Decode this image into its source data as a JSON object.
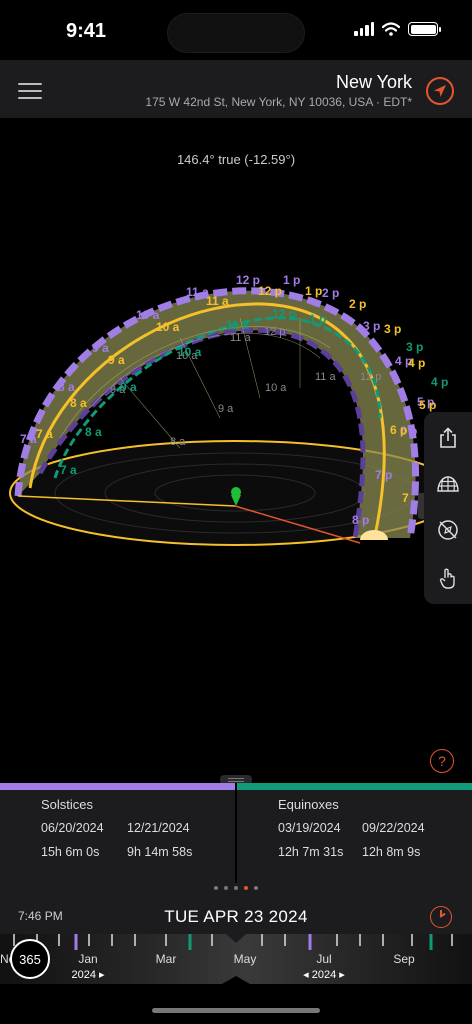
{
  "status_bar": {
    "time": "9:41"
  },
  "header": {
    "title": "New York",
    "address": "175 W 42nd St, New York, NY 10036, USA · EDT*"
  },
  "viewer": {
    "bearing": "146.4° true (-12.59°)",
    "help_label": "?",
    "winter_path_labels": [
      "7 a",
      "8 a",
      "9 a",
      "10 a",
      "11 a",
      "12 p",
      "1 p",
      "2 p",
      "3 p",
      "4 p"
    ],
    "equinox_path_labels": [
      "7 a",
      "8 a",
      "9 a",
      "10 a",
      "11 a",
      "12 p",
      "1 p",
      "2 p",
      "3 p",
      "4 p",
      "5 p",
      "6 p",
      "7 p"
    ],
    "summer_path_labels": [
      "7 a",
      "8 a",
      "9 a",
      "10 a",
      "11 a",
      "12 p",
      "1 p",
      "2 p",
      "3 p",
      "4 p",
      "5 p",
      "6 p",
      "7 p",
      "8 p"
    ],
    "today_path_labels": [
      "7 a",
      "8 a",
      "9 a",
      "10 a",
      "11 a",
      "12 p",
      "1 p",
      "2 p",
      "3 p",
      "4 p",
      "5 p",
      "6 p",
      "7"
    ],
    "colors": {
      "summer": "#a17de6",
      "winter": "#0f9b78",
      "today": "#f5c02a",
      "accent": "#e4572e"
    }
  },
  "toolbar": {
    "items": [
      {
        "name": "share-icon"
      },
      {
        "name": "globe-icon"
      },
      {
        "name": "compass-off-icon"
      },
      {
        "name": "hand-pointer-icon"
      }
    ]
  },
  "solstices": {
    "title": "Solstices",
    "summer_date": "06/20/2024",
    "winter_date": "12/21/2024",
    "summer_duration": "15h 6m 0s",
    "winter_duration": "9h 14m 58s"
  },
  "equinoxes": {
    "title": "Equinoxes",
    "spring_date": "03/19/2024",
    "autumn_date": "09/22/2024",
    "spring_duration": "12h 7m 31s",
    "autumn_duration": "12h 8m 9s"
  },
  "date_bar": {
    "current_time": "7:46 PM",
    "current_date": "TUE APR 23 2024",
    "day_count": "365",
    "months": [
      "Jan",
      "Mar",
      "May",
      "Jul",
      "Sep"
    ],
    "year_left": "2024 ▸",
    "year_right": "◂ 2024 ▸",
    "edge_label": "Nc"
  }
}
